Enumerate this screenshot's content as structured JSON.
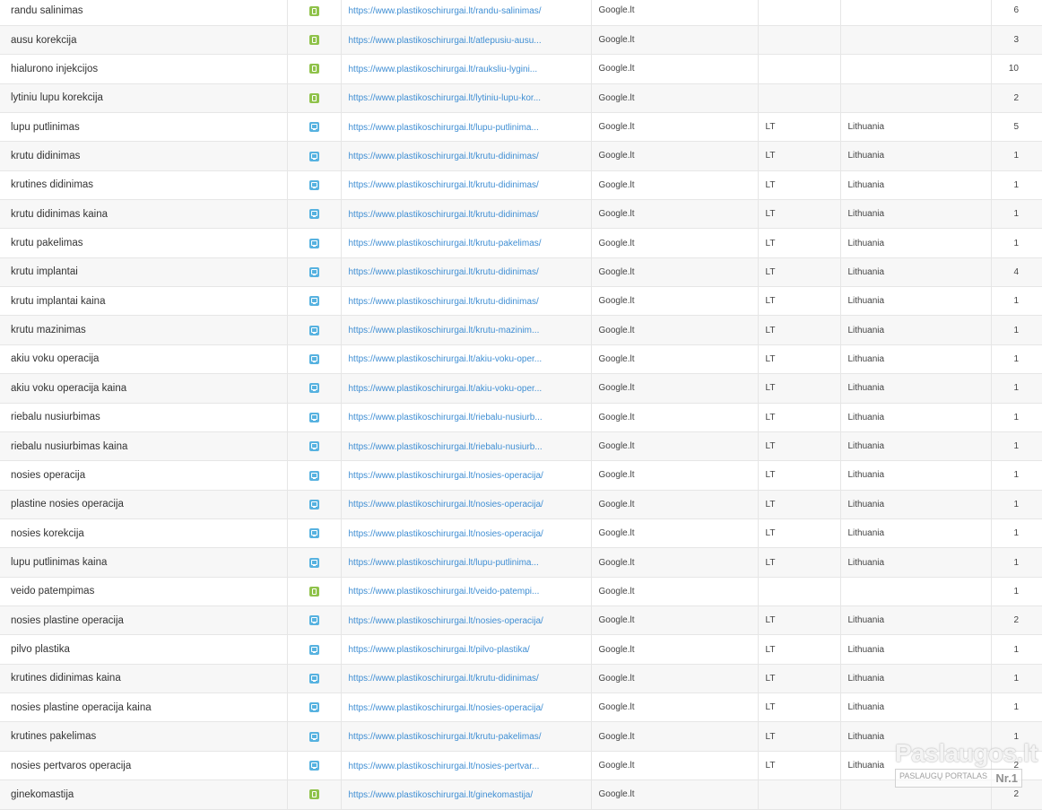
{
  "rows": [
    {
      "keyword": "randu salinimas",
      "device": "mobile",
      "url": "https://www.plastikoschirurgai.lt/randu-salinimas/",
      "engine": "Google.lt",
      "cc": "",
      "country": "",
      "count": "6"
    },
    {
      "keyword": "ausu korekcija",
      "device": "mobile",
      "url": "https://www.plastikoschirurgai.lt/atlepusiu-ausu...",
      "engine": "Google.lt",
      "cc": "",
      "country": "",
      "count": "3"
    },
    {
      "keyword": "hialurono injekcijos",
      "device": "mobile",
      "url": "https://www.plastikoschirurgai.lt/rauksliu-lygini...",
      "engine": "Google.lt",
      "cc": "",
      "country": "",
      "count": "10"
    },
    {
      "keyword": "lytiniu lupu korekcija",
      "device": "mobile",
      "url": "https://www.plastikoschirurgai.lt/lytiniu-lupu-kor...",
      "engine": "Google.lt",
      "cc": "",
      "country": "",
      "count": "2"
    },
    {
      "keyword": "lupu putlinimas",
      "device": "desktop",
      "url": "https://www.plastikoschirurgai.lt/lupu-putlinima...",
      "engine": "Google.lt",
      "cc": "LT",
      "country": "Lithuania",
      "count": "5"
    },
    {
      "keyword": "krutu didinimas",
      "device": "desktop",
      "url": "https://www.plastikoschirurgai.lt/krutu-didinimas/",
      "engine": "Google.lt",
      "cc": "LT",
      "country": "Lithuania",
      "count": "1"
    },
    {
      "keyword": "krutines didinimas",
      "device": "desktop",
      "url": "https://www.plastikoschirurgai.lt/krutu-didinimas/",
      "engine": "Google.lt",
      "cc": "LT",
      "country": "Lithuania",
      "count": "1"
    },
    {
      "keyword": "krutu didinimas kaina",
      "device": "desktop",
      "url": "https://www.plastikoschirurgai.lt/krutu-didinimas/",
      "engine": "Google.lt",
      "cc": "LT",
      "country": "Lithuania",
      "count": "1"
    },
    {
      "keyword": "krutu pakelimas",
      "device": "desktop",
      "url": "https://www.plastikoschirurgai.lt/krutu-pakelimas/",
      "engine": "Google.lt",
      "cc": "LT",
      "country": "Lithuania",
      "count": "1"
    },
    {
      "keyword": "krutu implantai",
      "device": "desktop",
      "url": "https://www.plastikoschirurgai.lt/krutu-didinimas/",
      "engine": "Google.lt",
      "cc": "LT",
      "country": "Lithuania",
      "count": "4"
    },
    {
      "keyword": "krutu implantai kaina",
      "device": "desktop",
      "url": "https://www.plastikoschirurgai.lt/krutu-didinimas/",
      "engine": "Google.lt",
      "cc": "LT",
      "country": "Lithuania",
      "count": "1"
    },
    {
      "keyword": "krutu mazinimas",
      "device": "desktop",
      "url": "https://www.plastikoschirurgai.lt/krutu-mazinim...",
      "engine": "Google.lt",
      "cc": "LT",
      "country": "Lithuania",
      "count": "1"
    },
    {
      "keyword": "akiu voku operacija",
      "device": "desktop",
      "url": "https://www.plastikoschirurgai.lt/akiu-voku-oper...",
      "engine": "Google.lt",
      "cc": "LT",
      "country": "Lithuania",
      "count": "1"
    },
    {
      "keyword": "akiu voku operacija kaina",
      "device": "desktop",
      "url": "https://www.plastikoschirurgai.lt/akiu-voku-oper...",
      "engine": "Google.lt",
      "cc": "LT",
      "country": "Lithuania",
      "count": "1"
    },
    {
      "keyword": "riebalu nusiurbimas",
      "device": "desktop",
      "url": "https://www.plastikoschirurgai.lt/riebalu-nusiurb...",
      "engine": "Google.lt",
      "cc": "LT",
      "country": "Lithuania",
      "count": "1"
    },
    {
      "keyword": "riebalu nusiurbimas kaina",
      "device": "desktop",
      "url": "https://www.plastikoschirurgai.lt/riebalu-nusiurb...",
      "engine": "Google.lt",
      "cc": "LT",
      "country": "Lithuania",
      "count": "1"
    },
    {
      "keyword": "nosies operacija",
      "device": "desktop",
      "url": "https://www.plastikoschirurgai.lt/nosies-operacija/",
      "engine": "Google.lt",
      "cc": "LT",
      "country": "Lithuania",
      "count": "1"
    },
    {
      "keyword": "plastine nosies operacija",
      "device": "desktop",
      "url": "https://www.plastikoschirurgai.lt/nosies-operacija/",
      "engine": "Google.lt",
      "cc": "LT",
      "country": "Lithuania",
      "count": "1"
    },
    {
      "keyword": "nosies korekcija",
      "device": "desktop",
      "url": "https://www.plastikoschirurgai.lt/nosies-operacija/",
      "engine": "Google.lt",
      "cc": "LT",
      "country": "Lithuania",
      "count": "1"
    },
    {
      "keyword": "lupu putlinimas kaina",
      "device": "desktop",
      "url": "https://www.plastikoschirurgai.lt/lupu-putlinima...",
      "engine": "Google.lt",
      "cc": "LT",
      "country": "Lithuania",
      "count": "1"
    },
    {
      "keyword": "veido patempimas",
      "device": "mobile",
      "url": "https://www.plastikoschirurgai.lt/veido-patempi...",
      "engine": "Google.lt",
      "cc": "",
      "country": "",
      "count": "1"
    },
    {
      "keyword": "nosies plastine operacija",
      "device": "desktop",
      "url": "https://www.plastikoschirurgai.lt/nosies-operacija/",
      "engine": "Google.lt",
      "cc": "LT",
      "country": "Lithuania",
      "count": "2"
    },
    {
      "keyword": "pilvo plastika",
      "device": "desktop",
      "url": "https://www.plastikoschirurgai.lt/pilvo-plastika/",
      "engine": "Google.lt",
      "cc": "LT",
      "country": "Lithuania",
      "count": "1"
    },
    {
      "keyword": "krutines didinimas kaina",
      "device": "desktop",
      "url": "https://www.plastikoschirurgai.lt/krutu-didinimas/",
      "engine": "Google.lt",
      "cc": "LT",
      "country": "Lithuania",
      "count": "1"
    },
    {
      "keyword": "nosies plastine operacija kaina",
      "device": "desktop",
      "url": "https://www.plastikoschirurgai.lt/nosies-operacija/",
      "engine": "Google.lt",
      "cc": "LT",
      "country": "Lithuania",
      "count": "1"
    },
    {
      "keyword": "krutines pakelimas",
      "device": "desktop",
      "url": "https://www.plastikoschirurgai.lt/krutu-pakelimas/",
      "engine": "Google.lt",
      "cc": "LT",
      "country": "Lithuania",
      "count": "1"
    },
    {
      "keyword": "nosies pertvaros operacija",
      "device": "desktop",
      "url": "https://www.plastikoschirurgai.lt/nosies-pertvar...",
      "engine": "Google.lt",
      "cc": "LT",
      "country": "Lithuania",
      "count": "2"
    },
    {
      "keyword": "ginekomastija",
      "device": "mobile",
      "url": "https://www.plastikoschirurgai.lt/ginekomastija/",
      "engine": "Google.lt",
      "cc": "",
      "country": "",
      "count": "2"
    }
  ],
  "device_icons": {
    "mobile": "mobile-device-icon",
    "desktop": "desktop-device-icon"
  },
  "colors": {
    "link": "#3f8ed3",
    "mobile_icon": "#8fc24a",
    "desktop_icon": "#57b2e0",
    "row_alt": "#f7f7f7"
  },
  "watermark": {
    "brand": "Paslaugos.lt",
    "tagline": "PASLAUGŲ PORTALAS",
    "rank": "Nr.1"
  }
}
